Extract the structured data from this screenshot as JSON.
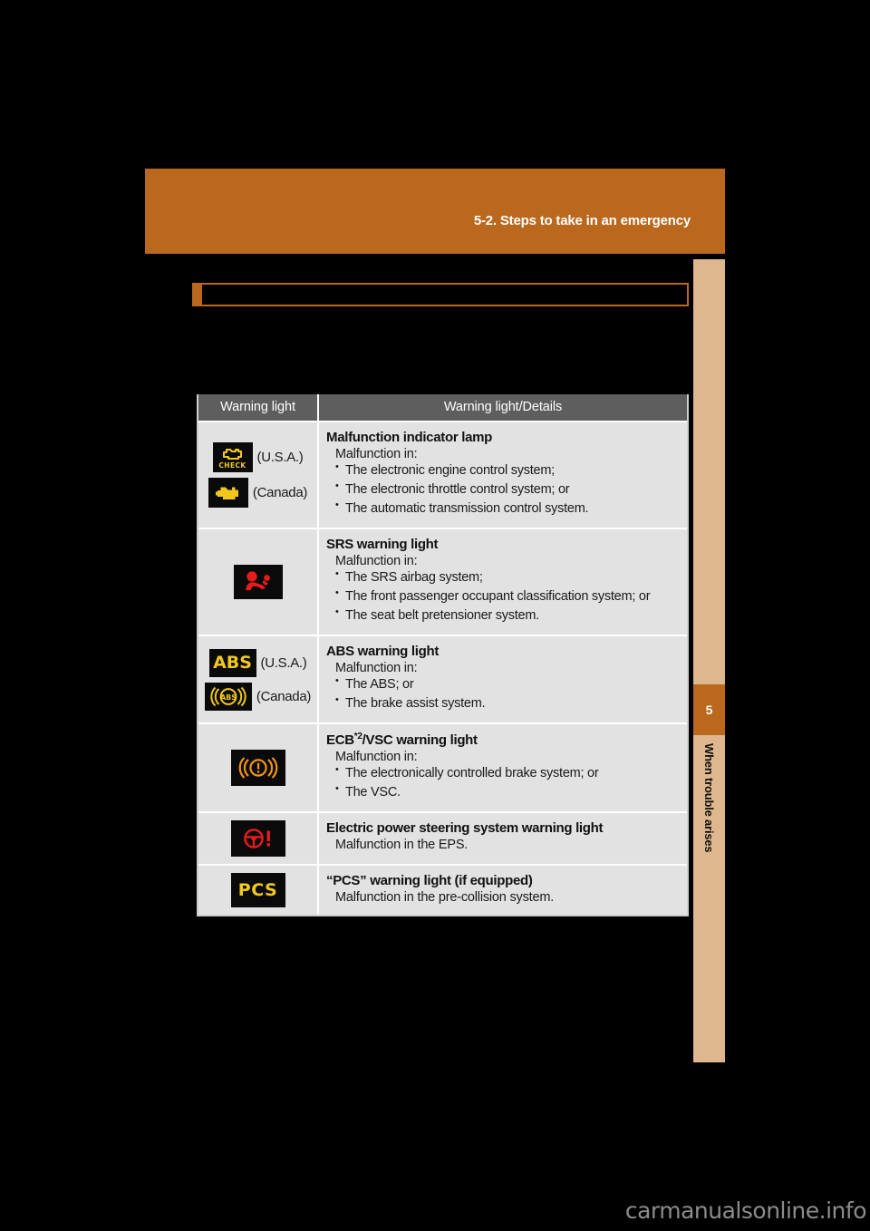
{
  "header": {
    "title": "5-2. Steps to take in an emergency"
  },
  "section": {
    "title": ""
  },
  "table": {
    "columns": [
      "Warning light",
      "Warning light/Details"
    ],
    "rows": [
      {
        "icons": [
          {
            "name": "malfunction-indicator-lamp-usa-icon",
            "glyph": "engine-check",
            "label": "(U.S.A.)",
            "chip_text": "CHECK",
            "color": "#f2c81e"
          },
          {
            "name": "malfunction-indicator-lamp-canada-icon",
            "glyph": "engine-solid",
            "label": "(Canada)",
            "chip_text": "",
            "color": "#f2c81e"
          }
        ],
        "title": "Malfunction indicator lamp",
        "subtitle": "Malfunction in:",
        "bullets": [
          "The electronic engine control system;",
          "The electronic throttle control system; or",
          "The automatic transmission control system."
        ]
      },
      {
        "icons": [
          {
            "name": "srs-airbag-warning-icon",
            "glyph": "srs-figure",
            "label": "",
            "chip_text": "",
            "color": "#e81c1c"
          }
        ],
        "title": "SRS warning light",
        "subtitle": "Malfunction in:",
        "bullets": [
          "The SRS airbag system;",
          "The front passenger occupant classification system; or",
          "The seat belt pretensioner system."
        ]
      },
      {
        "icons": [
          {
            "name": "abs-warning-usa-icon",
            "glyph": "abs-text",
            "label": "(U.S.A.)",
            "chip_text": "ABS",
            "color": "#f2c81e"
          },
          {
            "name": "abs-warning-canada-icon",
            "glyph": "abs-circle",
            "label": "(Canada)",
            "chip_text": "ABS",
            "color": "#f2c81e"
          }
        ],
        "title": "ABS warning light",
        "subtitle": "Malfunction in:",
        "bullets": [
          "The ABS; or",
          "The brake assist system."
        ]
      },
      {
        "icons": [
          {
            "name": "ecb-vsc-brake-warning-icon",
            "glyph": "brake-exclaim",
            "label": "",
            "chip_text": "",
            "color": "#f0941a"
          }
        ],
        "title": "ECB",
        "title_sup": "*2",
        "title_rest": "/VSC warning light",
        "subtitle": "Malfunction in:",
        "bullets": [
          "The electronically controlled brake system; or",
          "The VSC."
        ]
      },
      {
        "icons": [
          {
            "name": "electric-power-steering-warning-icon",
            "glyph": "steering-wheel-exclaim",
            "label": "",
            "chip_text": "",
            "color": "#e81c1c"
          }
        ],
        "title": "Electric power steering system warning light",
        "subtitle": "Malfunction in the EPS.",
        "bullets": []
      },
      {
        "icons": [
          {
            "name": "pcs-warning-icon",
            "glyph": "pcs-text",
            "label": "",
            "chip_text": "PCS",
            "color": "#f2c81e"
          }
        ],
        "title": "“PCS” warning light (if equipped)",
        "subtitle": "Malfunction in the pre-collision system.",
        "bullets": []
      }
    ]
  },
  "sidebar": {
    "chapter_number": "5",
    "chapter_label": "When trouble arises"
  },
  "watermark": {
    "text": "carmanualsonline.info"
  },
  "colors": {
    "accent_orange": "#b9681d",
    "sidebar_tan": "#dfb78e",
    "table_header_gray": "#5e5e5e",
    "table_row_gray": "#e2e2e2",
    "warning_amber": "#f2c81e",
    "warning_red": "#e81c1c",
    "warning_orange": "#f0941a"
  }
}
